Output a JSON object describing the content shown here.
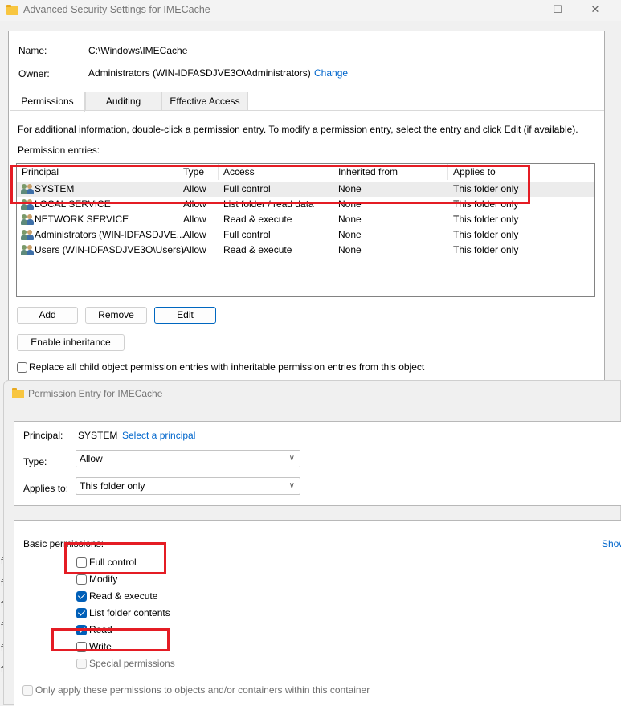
{
  "main_window": {
    "title": "Advanced Security Settings for IMECache",
    "controls": {
      "minimize": "—",
      "maximize": "☐",
      "close": "✕"
    },
    "name_label": "Name:",
    "name_value": "C:\\Windows\\IMECache",
    "owner_label": "Owner:",
    "owner_value": "Administrators (WIN-IDFASDJVE3O\\Administrators)",
    "owner_change_link": "Change",
    "tabs": [
      {
        "label": "Permissions",
        "active": true
      },
      {
        "label": "Auditing",
        "active": false
      },
      {
        "label": "Effective Access",
        "active": false
      }
    ],
    "info_text": "For additional information, double-click a permission entry. To modify a permission entry, select the entry and click Edit (if available).",
    "entries_label": "Permission entries:",
    "columns": [
      "Principal",
      "Type",
      "Access",
      "Inherited from",
      "Applies to"
    ],
    "rows": [
      {
        "principal": "SYSTEM",
        "type": "Allow",
        "access": "Full control",
        "inherited": "None",
        "applies": "This folder only",
        "selected": true
      },
      {
        "principal": "LOCAL SERVICE",
        "type": "Allow",
        "access": "List folder / read data",
        "inherited": "None",
        "applies": "This folder only",
        "selected": false
      },
      {
        "principal": "NETWORK SERVICE",
        "type": "Allow",
        "access": "Read & execute",
        "inherited": "None",
        "applies": "This folder only",
        "selected": false
      },
      {
        "principal": "Administrators (WIN-IDFASDJVE...",
        "type": "Allow",
        "access": "Full control",
        "inherited": "None",
        "applies": "This folder only",
        "selected": false
      },
      {
        "principal": "Users (WIN-IDFASDJVE3O\\Users)",
        "type": "Allow",
        "access": "Read & execute",
        "inherited": "None",
        "applies": "This folder only",
        "selected": false
      }
    ],
    "buttons": {
      "add": "Add",
      "remove": "Remove",
      "edit": "Edit",
      "enable_inheritance": "Enable inheritance"
    },
    "replace_checkbox": {
      "label": "Replace all child object permission entries with inheritable permission entries from this object",
      "checked": false
    }
  },
  "entry_window": {
    "title": "Permission Entry for IMECache",
    "principal_label": "Principal:",
    "principal_value": "SYSTEM",
    "select_principal_link": "Select a principal",
    "type_label": "Type:",
    "type_value": "Allow",
    "applies_label": "Applies to:",
    "applies_value": "This folder only",
    "basic_permissions_label": "Basic permissions:",
    "show_advanced_link": "Show",
    "permissions": [
      {
        "label": "Full control",
        "checked": false,
        "disabled": false
      },
      {
        "label": "Modify",
        "checked": false,
        "disabled": false
      },
      {
        "label": "Read & execute",
        "checked": true,
        "disabled": false
      },
      {
        "label": "List folder contents",
        "checked": true,
        "disabled": false
      },
      {
        "label": "Read",
        "checked": true,
        "disabled": false
      },
      {
        "label": "Write",
        "checked": false,
        "disabled": false
      },
      {
        "label": "Special permissions",
        "checked": false,
        "disabled": true
      }
    ],
    "only_apply_checkbox": {
      "label": "Only apply these permissions to objects and/or containers within this container",
      "checked": false
    }
  },
  "background_gutter": [
    "f",
    "f",
    "f",
    "f",
    "f",
    "f"
  ],
  "colors": {
    "link": "#0066cc",
    "highlight": "#e41c24",
    "checkbox_accent": "#005fb8"
  }
}
